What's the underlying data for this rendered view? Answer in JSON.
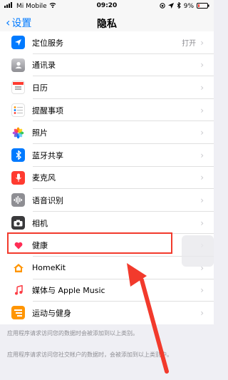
{
  "status": {
    "carrier": "Mi Mobile",
    "time": "09:20",
    "battery": "9%"
  },
  "nav": {
    "back_label": "设置",
    "title": "隐私"
  },
  "rows": [
    {
      "label": "定位服务",
      "value": "打开",
      "icon": "location-icon",
      "color": "#007aff"
    },
    {
      "label": "通讯录",
      "value": "",
      "icon": "contacts-icon",
      "color": "#a7a7aa"
    },
    {
      "label": "日历",
      "value": "",
      "icon": "calendar-icon",
      "color": "#ffffff"
    },
    {
      "label": "提醒事项",
      "value": "",
      "icon": "reminders-icon",
      "color": "#ffffff"
    },
    {
      "label": "照片",
      "value": "",
      "icon": "photos-icon",
      "color": "#ffffff"
    },
    {
      "label": "蓝牙共享",
      "value": "",
      "icon": "bluetooth-icon",
      "color": "#007aff"
    },
    {
      "label": "麦克风",
      "value": "",
      "icon": "microphone-icon",
      "color": "#ff3b30"
    },
    {
      "label": "语音识别",
      "value": "",
      "icon": "speech-recognition-icon",
      "color": "#8e8e93"
    },
    {
      "label": "相机",
      "value": "",
      "icon": "camera-icon",
      "color": "#3a3a3c"
    },
    {
      "label": "健康",
      "value": "",
      "icon": "health-icon",
      "color": "#ffffff"
    },
    {
      "label": "HomeKit",
      "value": "",
      "icon": "homekit-icon",
      "color": "#ff9500"
    },
    {
      "label": "媒体与 Apple Music",
      "value": "",
      "icon": "music-icon",
      "color": "#ffffff"
    },
    {
      "label": "运动与健身",
      "value": "",
      "icon": "motion-fitness-icon",
      "color": "#ff9500"
    }
  ],
  "footers": [
    "应用程序请求访问您的数据时会被添加到以上类别。",
    "应用程序请求访问您社交帐户的数据时，会被添加到以上类别中。"
  ],
  "annotation": {
    "color": "#f23a2c",
    "highlight_target": "健康"
  }
}
